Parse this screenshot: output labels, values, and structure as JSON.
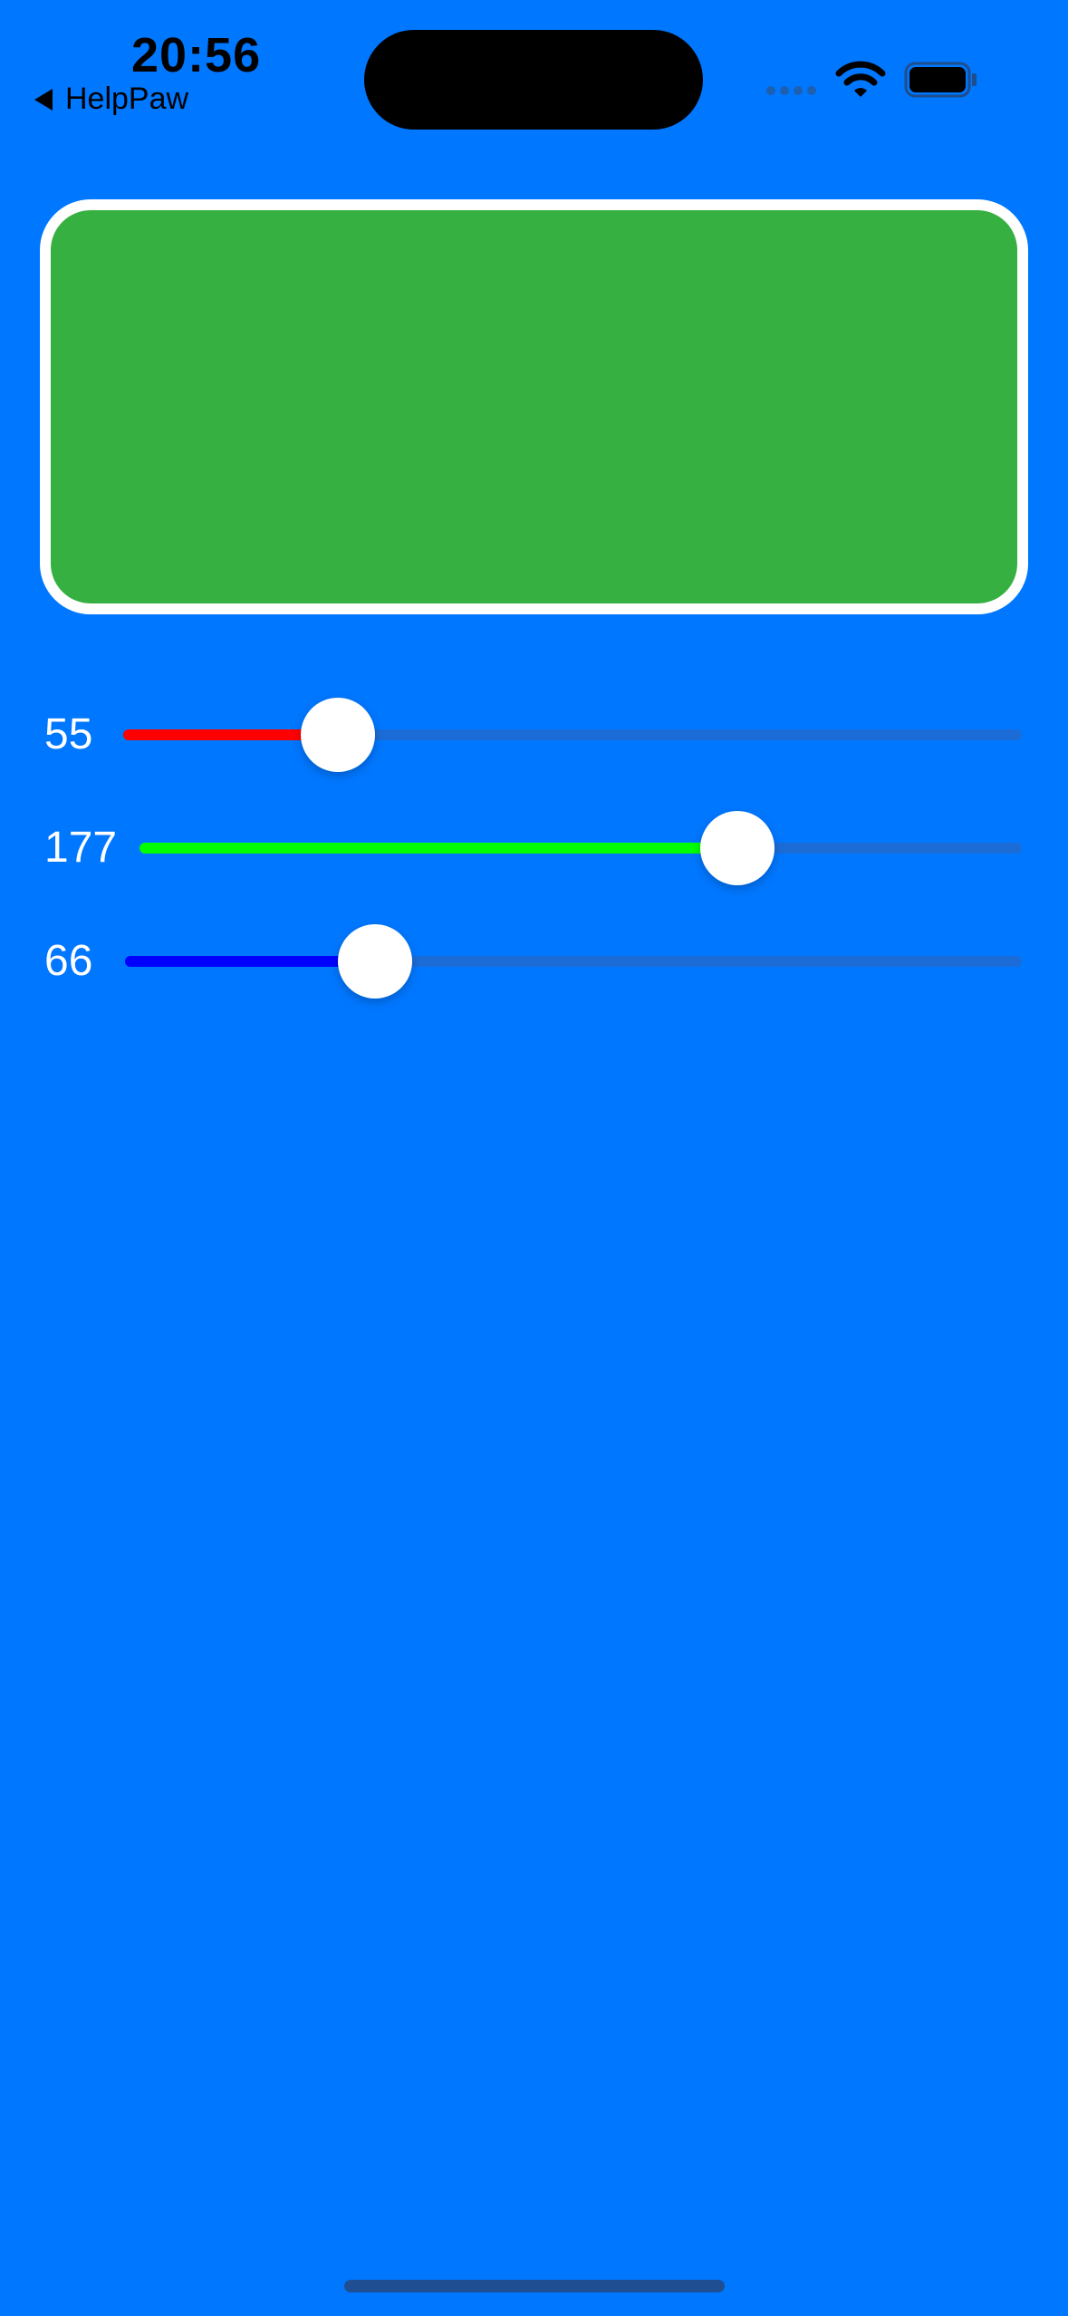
{
  "status_bar": {
    "time": "20:56",
    "back_label": "HelpPaw",
    "icons": [
      "cellular-signal-icon",
      "wifi-icon",
      "battery-icon"
    ]
  },
  "preview": {
    "color": "#37B042"
  },
  "sliders": [
    {
      "name": "red",
      "value": "55",
      "level": 55,
      "max": 255,
      "color": "#FF0000"
    },
    {
      "name": "green",
      "value": "177",
      "level": 177,
      "max": 255,
      "color": "#00FF00"
    },
    {
      "name": "blue",
      "value": "66",
      "level": 66,
      "max": 255,
      "color": "#0000FF"
    }
  ],
  "colors": {
    "background": "#0077FF",
    "track": "#1C6CD8",
    "thumb": "#FFFFFF"
  }
}
